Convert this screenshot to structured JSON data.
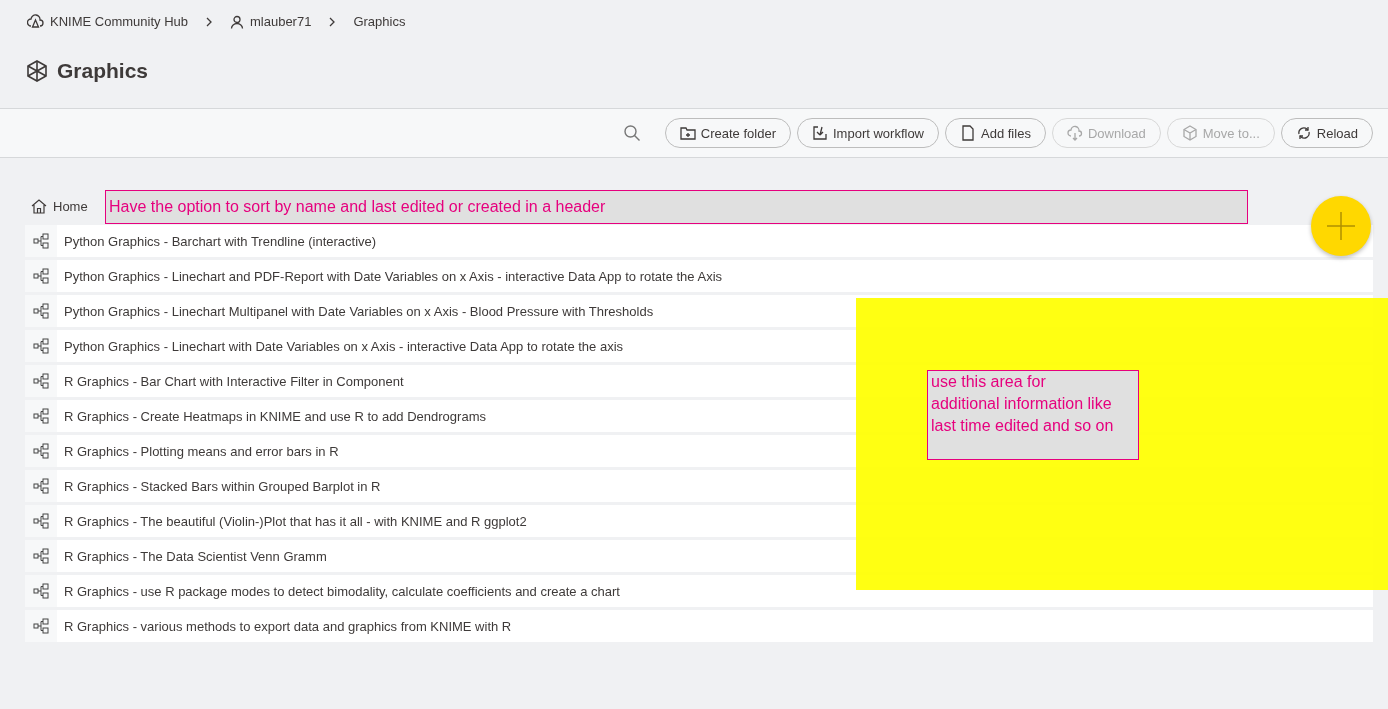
{
  "breadcrumb": [
    {
      "kind": "hub",
      "label": "KNIME Community Hub"
    },
    {
      "kind": "user",
      "label": "mlauber71"
    },
    {
      "kind": "current",
      "label": "Graphics"
    }
  ],
  "title": "Graphics",
  "toolbar": {
    "buttons": [
      {
        "kind": "create-folder",
        "label": "Create folder",
        "disabled": false
      },
      {
        "kind": "import",
        "label": "Import workflow",
        "disabled": false
      },
      {
        "kind": "add-files",
        "label": "Add files",
        "disabled": false
      },
      {
        "kind": "download",
        "label": "Download",
        "disabled": true
      },
      {
        "kind": "move",
        "label": "Move to...",
        "disabled": true
      },
      {
        "kind": "reload",
        "label": "Reload",
        "disabled": false
      }
    ]
  },
  "path": "Home",
  "items": [
    "Python Graphics - Barchart with Trendline (interactive)",
    "Python Graphics - Linechart and PDF-Report with Date Variables on x Axis - interactive Data App to rotate the Axis",
    "Python Graphics - Linechart Multipanel with Date Variables on x Axis - Blood Pressure with Thresholds",
    "Python Graphics - Linechart with Date Variables on x Axis - interactive Data App to rotate the axis",
    "R Graphics - Bar Chart with Interactive Filter in Component",
    "R Graphics - Create Heatmaps in KNIME and use R to add Dendrograms",
    "R Graphics - Plotting means and error bars in R",
    "R Graphics - Stacked Bars within Grouped Barplot in R",
    "R Graphics - The beautiful (Violin-)Plot that has it all - with KNIME and R ggplot2",
    "R Graphics - The Data Scientist Venn Gramm",
    "R Graphics - use R package modes to detect bimodality, calculate coefficients and create a chart",
    "R Graphics - various methods to export data and graphics from KNIME with R"
  ],
  "annotations": {
    "header_note": "Have the option to sort by name and last edited or created in a header",
    "area_note": "use this area for additional information like last time edited and so on"
  }
}
